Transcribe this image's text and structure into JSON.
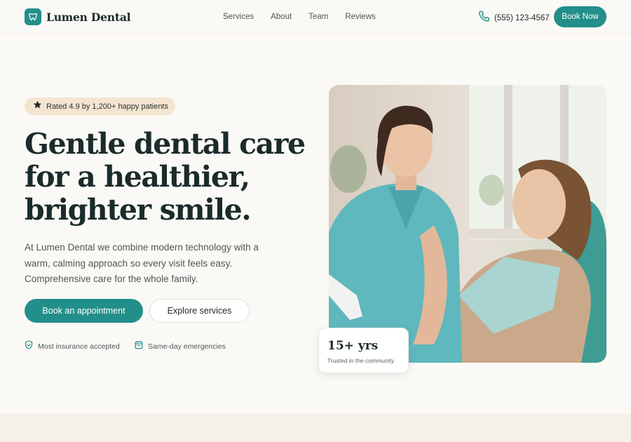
{
  "brand": {
    "name": "Lumen Dental",
    "accent": "#238f8a"
  },
  "nav": {
    "items": [
      "Services",
      "About",
      "Team",
      "Reviews"
    ]
  },
  "header": {
    "phone": "(555) 123-4567",
    "cta": "Book Now"
  },
  "hero": {
    "rating": "Rated 4.9 by 1,200+ happy patients",
    "headline": [
      "Gentle dental care",
      "for a healthier,",
      "brighter smile."
    ],
    "description": "At Lumen Dental we combine modern technology with a warm, calming approach so every visit feels easy. Comprehensive care for the whole family.",
    "primary_cta": "Book an appointment",
    "secondary_cta": "Explore services",
    "features": [
      "Most insurance accepted",
      "Same-day emergencies"
    ]
  },
  "stat": {
    "value": "15+ yrs",
    "label": "Trusted in the community"
  },
  "icons": [
    "tooth-icon",
    "phone-icon",
    "star-icon",
    "shield-icon",
    "calendar-icon"
  ]
}
